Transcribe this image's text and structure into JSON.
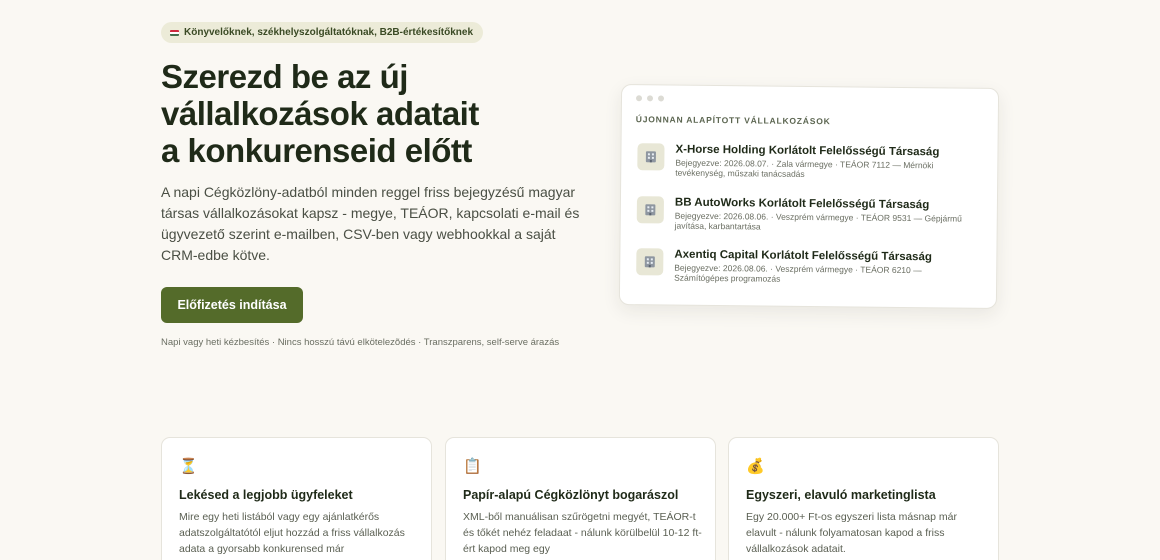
{
  "badge": {
    "text": "Könyvelőknek, székhelyszolgáltatóknak, B2B-értékesítőknek",
    "flag_colors": [
      "#cd2a3e",
      "#ffffff",
      "#436f4d"
    ]
  },
  "hero": {
    "title_lines": [
      "Szerezd be az új",
      "vállalkozások adatait",
      "a konkurenseid előtt"
    ],
    "description": "A napi Cégközlöny-adatból minden reggel friss bejegyzésű magyar társas vállalkozásokat kapsz - megye, TEÁOR, kapcsolati e-mail és ügyvezető szerint e-mailben, CSV-ben vagy webhookkal a saját CRM-edbe kötve.",
    "cta_label": "Előfizetés indítása",
    "cta_note": "Napi vagy heti kézbesítés · Nincs hosszú távú elkötelezõdés · Transzparens, self-serve árazás"
  },
  "preview": {
    "heading": "ÚJONNAN ALAPÍTOTT VÁLLALKOZÁSOK",
    "companies": [
      {
        "name": "X-Horse Holding Korlátolt Felelősségű Társaság",
        "meta": "Bejegyezve: 2026.08.07. · Zala vármegye · TEÁOR 7112 — Mérnöki tevékenység, műszaki tanácsadás",
        "icon": "building-icon"
      },
      {
        "name": "BB AutoWorks Korlátolt Felelősségű Társaság",
        "meta": "Bejegyezve: 2026.08.06. · Veszprém vármegye · TEÁOR 9531 — Gépjármű javítása, karbantartása",
        "icon": "building-icon"
      },
      {
        "name": "Axentiq Capital Korlátolt Felelősségű Társaság",
        "meta": "Bejegyezve: 2026.08.06. · Veszprém vármegye · TEÁOR 6210 — Számítógépes programozás",
        "icon": "building-icon"
      }
    ]
  },
  "features": [
    {
      "icon": "hourglass-icon",
      "glyph": "⏳",
      "title": "Lekésed a legjobb ügyfeleket",
      "text": "Mire egy heti listából vagy egy ajánlatkérős adatszolgáltatótól eljut hozzád a friss vállalkozás adata a gyorsabb konkurensed már"
    },
    {
      "icon": "clipboard-icon",
      "glyph": "📋",
      "title": "Papír-alapú Cégközlönyt bogarászol",
      "text": "XML-ből manuálisan szűrögetni megyét, TEÁOR-t és tőkét nehéz feladaat - nálunk körülbelül 10-12 ft-ért kapod meg egy"
    },
    {
      "icon": "money-bag-icon",
      "glyph": "💰",
      "title": "Egyszeri, elavuló marketinglista",
      "text": "Egy 20.000+ Ft-os egyszeri lista másnap már elavult - nálunk folyamatosan kapod a friss vállalkozások adatait."
    }
  ]
}
